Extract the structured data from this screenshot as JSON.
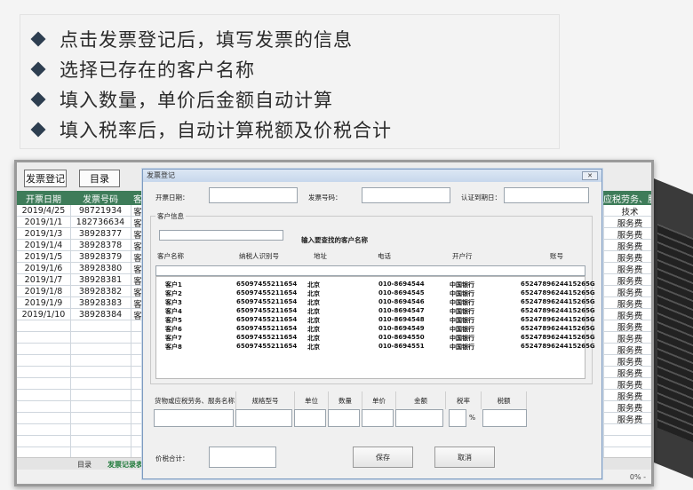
{
  "slide": {
    "bullets": [
      "点击发票登记后，填写发票的信息",
      "选择已存在的客户名称",
      "填入数量，单价后金额自动计算",
      "填入税率后，自动计算税额及价税合计"
    ]
  },
  "excel": {
    "toolbar": {
      "register_label": "发票登记",
      "directory_label": "目录"
    },
    "headers": {
      "date": "开票日期",
      "number": "发票号码",
      "customer_partial": "客",
      "goods_partial": "应税劳务、服"
    },
    "rows": [
      {
        "date": "2019/4/25",
        "number": "98721934",
        "c": "客",
        "goods": "技术"
      },
      {
        "date": "2019/1/1",
        "number": "182736634",
        "c": "客",
        "goods": "服务费"
      },
      {
        "date": "2019/1/3",
        "number": "38928377",
        "c": "客",
        "goods": "服务费"
      },
      {
        "date": "2019/1/4",
        "number": "38928378",
        "c": "客",
        "goods": "服务费"
      },
      {
        "date": "2019/1/5",
        "number": "38928379",
        "c": "客",
        "goods": "服务费"
      },
      {
        "date": "2019/1/6",
        "number": "38928380",
        "c": "客",
        "goods": "服务费"
      },
      {
        "date": "2019/1/7",
        "number": "38928381",
        "c": "客",
        "goods": "服务费"
      },
      {
        "date": "2019/1/8",
        "number": "38928382",
        "c": "客",
        "goods": "服务费"
      },
      {
        "date": "2019/1/9",
        "number": "38928383",
        "c": "客",
        "goods": "服务费"
      },
      {
        "date": "2019/1/10",
        "number": "38928384",
        "c": "客",
        "goods": "服务费"
      }
    ],
    "extra_goods": [
      "服务费",
      "服务费",
      "服务费",
      "服务费",
      "服务费",
      "服务费",
      "服务费",
      "服务费",
      "服务费"
    ],
    "sheet_tabs": {
      "tab1": "目录",
      "tab2": "发票记录表"
    },
    "zoom_text": "0% -"
  },
  "dialog": {
    "title": "发票登记",
    "close": "✕",
    "labels": {
      "date": "开票日期：",
      "number": "发票号码：",
      "auth_date": "认证到期日：",
      "customer_group": "客户信息",
      "search_hint": "输入要查找的客户名称",
      "total": "价税合计："
    },
    "list_headers": [
      "客户名称",
      "纳税人识别号",
      "地址",
      "电话",
      "开户行",
      "账号"
    ],
    "customers": [
      {
        "name": "客户1",
        "taxid": "65097455211654",
        "addr": "北京",
        "tel": "010-8694544",
        "bank": "中国银行",
        "acct": "6524789624415265G"
      },
      {
        "name": "客户2",
        "taxid": "65097455211654",
        "addr": "北京",
        "tel": "010-8694545",
        "bank": "中国银行",
        "acct": "6524789624415265G"
      },
      {
        "name": "客户3",
        "taxid": "65097455211654",
        "addr": "北京",
        "tel": "010-8694546",
        "bank": "中国银行",
        "acct": "6524789624415265G"
      },
      {
        "name": "客户4",
        "taxid": "65097455211654",
        "addr": "北京",
        "tel": "010-8694547",
        "bank": "中国银行",
        "acct": "6524789624415265G"
      },
      {
        "name": "客户5",
        "taxid": "65097455211654",
        "addr": "北京",
        "tel": "010-8694548",
        "bank": "中国银行",
        "acct": "6524789624415265G"
      },
      {
        "name": "客户6",
        "taxid": "65097455211654",
        "addr": "北京",
        "tel": "010-8694549",
        "bank": "中国银行",
        "acct": "6524789624415265G"
      },
      {
        "name": "客户7",
        "taxid": "65097455211654",
        "addr": "北京",
        "tel": "010-8694550",
        "bank": "中国银行",
        "acct": "6524789624415265G"
      },
      {
        "name": "客户8",
        "taxid": "65097455211654",
        "addr": "北京",
        "tel": "010-8694551",
        "bank": "中国银行",
        "acct": "6524789624415265G"
      }
    ],
    "form_headers": [
      "货物或应税劳务、服务名称",
      "规格型号",
      "单位",
      "数量",
      "单价",
      "金额",
      "税率",
      "税额"
    ],
    "percent": "%",
    "buttons": {
      "save": "保存",
      "cancel": "取消"
    }
  }
}
